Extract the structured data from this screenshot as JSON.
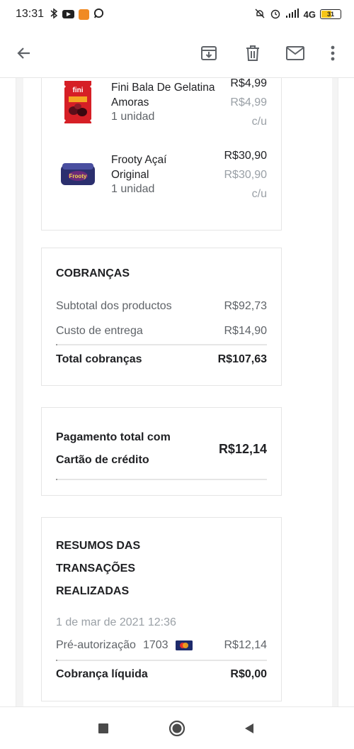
{
  "status_bar": {
    "time": "13:31",
    "network": "4G",
    "battery": "31",
    "icons": [
      "bluetooth-icon",
      "youtube-icon",
      "app-icon",
      "whatsapp-icon",
      "mute-icon",
      "alarm-icon",
      "signal-icon"
    ]
  },
  "toolbar": {
    "icons": [
      "back-arrow-icon",
      "archive-icon",
      "delete-icon",
      "mail-icon",
      "more-vert-icon"
    ]
  },
  "products": [
    {
      "name_line1": "Fini Bala De Gelatina",
      "name_line2": "Amoras",
      "qty": "1 unidad",
      "price": "R$4,99",
      "unit_price": "R$4,99",
      "unit_label": "c/u"
    },
    {
      "name_line1": "Frooty Açaí",
      "name_line2": "Original",
      "qty": "1 unidad",
      "price": "R$30,90",
      "unit_price": "R$30,90",
      "unit_label": "c/u"
    }
  ],
  "charges": {
    "title": "COBRANÇAS",
    "subtotal_label": "Subtotal dos productos",
    "subtotal_value": "R$92,73",
    "delivery_label": "Custo de entrega",
    "delivery_value": "R$14,90",
    "total_label": "Total cobranças",
    "total_value": "R$107,63"
  },
  "payment": {
    "label_line1": "Pagamento total com",
    "label_line2": "Cartão de crédito",
    "value": "R$12,14"
  },
  "transactions": {
    "title_line1": "RESUMOS DAS",
    "title_line2": "TRANSAÇÕES",
    "title_line3": "REALIZADAS",
    "date": "1 de mar de 2021 12:36",
    "preauth_label": "Pré-autorização",
    "card_last4": "1703",
    "preauth_value": "R$12,14",
    "net_label": "Cobrança líquida",
    "net_value": "R$0,00"
  },
  "colors": {
    "text": "#202124",
    "muted": "#5f6368",
    "light": "#9aa0a6",
    "frame_bg": "#f4f4f4"
  }
}
